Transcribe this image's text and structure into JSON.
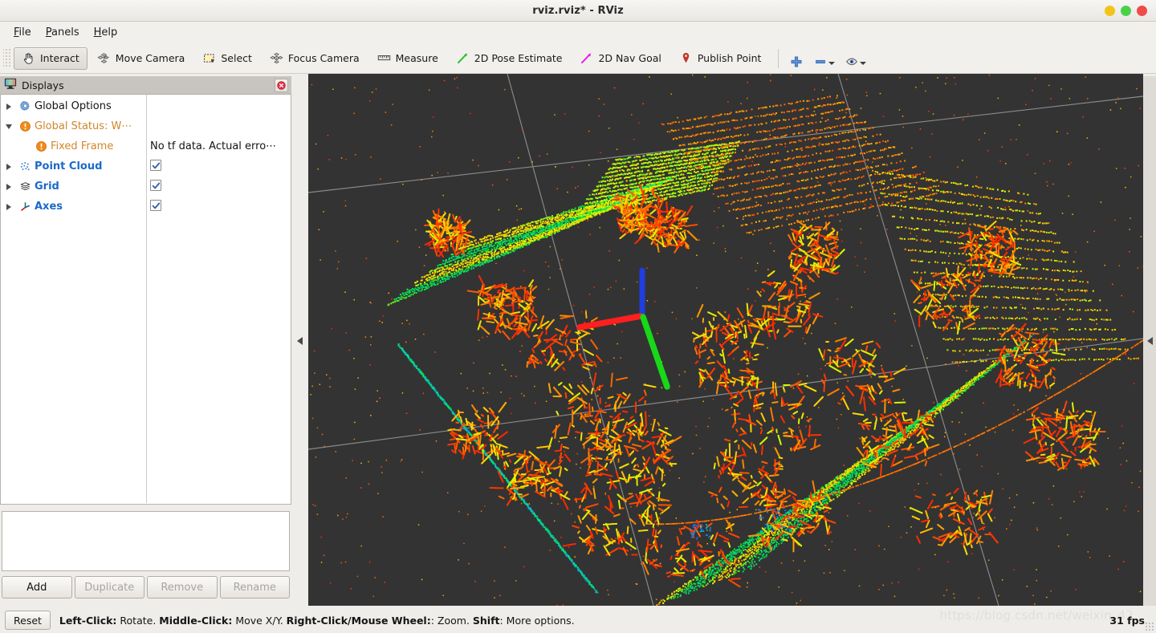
{
  "window": {
    "title": "rviz.rviz* - RViz",
    "controls": [
      {
        "name": "minimize",
        "color": "#f0c419"
      },
      {
        "name": "maximize",
        "color": "#4ad14a"
      },
      {
        "name": "close",
        "color": "#f04a4a"
      }
    ]
  },
  "menubar": {
    "items": [
      {
        "label": "File",
        "mnemonic": "F"
      },
      {
        "label": "Panels",
        "mnemonic": "P"
      },
      {
        "label": "Help",
        "mnemonic": "H"
      }
    ]
  },
  "toolbar": {
    "tools": [
      {
        "label": "Interact",
        "icon": "hand-cursor-icon",
        "active": true
      },
      {
        "label": "Move Camera",
        "icon": "move-camera-icon",
        "active": false
      },
      {
        "label": "Select",
        "icon": "select-box-icon",
        "active": false
      },
      {
        "label": "Focus Camera",
        "icon": "focus-camera-icon",
        "active": false
      },
      {
        "label": "Measure",
        "icon": "ruler-icon",
        "active": false
      },
      {
        "label": "2D Pose Estimate",
        "icon": "green-arrow-icon",
        "active": false
      },
      {
        "label": "2D Nav Goal",
        "icon": "magenta-arrow-icon",
        "active": false
      },
      {
        "label": "Publish Point",
        "icon": "map-pin-icon",
        "active": false
      }
    ],
    "extra": [
      {
        "name": "add-tool-button",
        "icon": "plus-icon",
        "dropdown": false
      },
      {
        "name": "remove-tool-button",
        "icon": "minus-icon",
        "dropdown": true
      },
      {
        "name": "tool-visibility-button",
        "icon": "eye-icon",
        "dropdown": true
      }
    ]
  },
  "displays_panel": {
    "title": "Displays",
    "title_icon": "monitor-icon",
    "close_icon": "close-icon",
    "tree": [
      {
        "label": "Global Options",
        "icon": "gear-icon",
        "style": "plain",
        "expander": "collapsed",
        "indent": 0,
        "value": "",
        "checkbox": false
      },
      {
        "label": "Global Status: W⋯",
        "icon": "warning-icon",
        "style": "warn",
        "expander": "expanded",
        "indent": 0,
        "value": "",
        "checkbox": false
      },
      {
        "label": "Fixed Frame",
        "icon": "warning-icon",
        "style": "warn",
        "expander": "none",
        "indent": 1,
        "value": "No tf data.  Actual erro⋯",
        "checkbox": false
      },
      {
        "label": "Point Cloud",
        "icon": "point-cloud-icon",
        "style": "blue",
        "expander": "collapsed",
        "indent": 0,
        "value": "",
        "checkbox": true,
        "checked": true
      },
      {
        "label": "Grid",
        "icon": "grid-icon",
        "style": "blue",
        "expander": "collapsed",
        "indent": 0,
        "value": "",
        "checkbox": true,
        "checked": true
      },
      {
        "label": "Axes",
        "icon": "axes-icon",
        "style": "blue",
        "expander": "collapsed",
        "indent": 0,
        "value": "",
        "checkbox": true,
        "checked": true
      }
    ],
    "description": "",
    "buttons": [
      {
        "label": "Add",
        "enabled": true
      },
      {
        "label": "Duplicate",
        "enabled": false
      },
      {
        "label": "Remove",
        "enabled": false
      },
      {
        "label": "Rename",
        "enabled": false
      }
    ]
  },
  "viewport": {
    "background_color": "#333333",
    "grid_color": "#999999",
    "axes": {
      "x_color": "#ff1f1f",
      "y_color": "#18d818",
      "z_color": "#1f3fe0"
    },
    "point_cloud_palette": [
      "#ff1100",
      "#ff5500",
      "#ff9900",
      "#ffdd00",
      "#ccff00",
      "#55ee22",
      "#00dd44",
      "#00ddbb",
      "#2255ff"
    ]
  },
  "statusbar": {
    "reset_label": "Reset",
    "hint_segments": [
      {
        "text": "Left-Click:",
        "bold": true
      },
      {
        "text": " Rotate. ",
        "bold": false
      },
      {
        "text": "Middle-Click:",
        "bold": true
      },
      {
        "text": " Move X/Y. ",
        "bold": false
      },
      {
        "text": "Right-Click/Mouse Wheel:",
        "bold": true
      },
      {
        "text": ": Zoom. ",
        "bold": false
      },
      {
        "text": "Shift",
        "bold": true
      },
      {
        "text": ": More options.",
        "bold": false
      }
    ],
    "fps": "31 fps",
    "watermark": "https://blog.csdn.net/weixin_42"
  }
}
